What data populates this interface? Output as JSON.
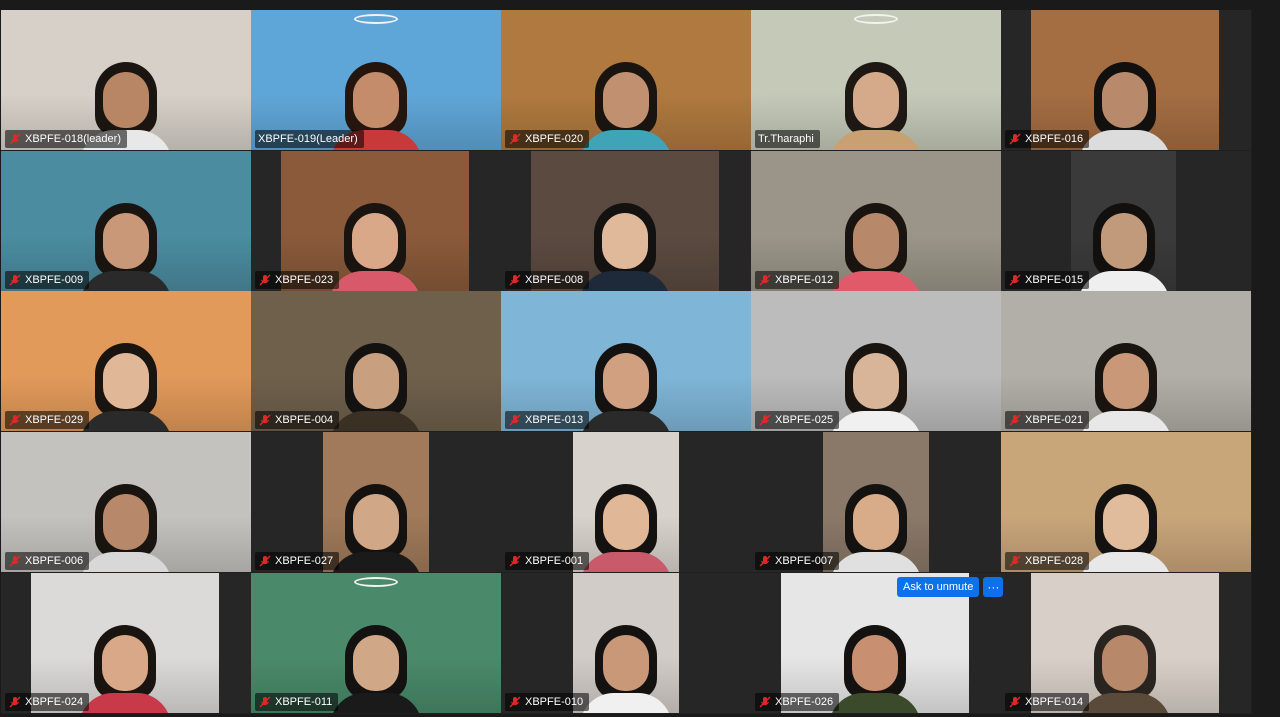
{
  "meeting": {
    "icons": {
      "muted_mic": "muted-mic-icon",
      "halo": "halo-effect-icon",
      "more": "ellipsis-icon"
    },
    "colors": {
      "active_speaker_border": "#23d959",
      "action_blue": "#0e71eb",
      "muted_red": "#e02828"
    },
    "participants": [
      {
        "name": "XBPFE-018(leader)",
        "bg": "#d6d0c8",
        "hair": "#1b1512",
        "skin": "#b88664",
        "cloth": "#e8e8e8",
        "muted": true
      },
      {
        "name": "XBPFE-019(Leader)",
        "bg": "#5fa6d8",
        "hair": "#24160f",
        "skin": "#c48c6a",
        "cloth": "#c83a3a",
        "muted": false,
        "active": true,
        "halo": true
      },
      {
        "name": "XBPFE-020",
        "bg": "#b0793f",
        "hair": "#1a1410",
        "skin": "#c09070",
        "cloth": "#3fa4b8",
        "muted": true
      },
      {
        "name": "Tr.Tharaphi",
        "bg": "#c4c9b8",
        "hair": "#1e1814",
        "skin": "#d4aa8a",
        "cloth": "#c8a071",
        "muted": false,
        "halo": true
      },
      {
        "name": "XBPFE-016",
        "bg": "#a46d42",
        "hair": "#12100e",
        "skin": "#b8896a",
        "cloth": "#dcdcdc",
        "muted": true
      },
      {
        "name": "XBPFE-009",
        "bg": "#4b8ca0",
        "hair": "#1a1410",
        "skin": "#c89878",
        "cloth": "#2a2a2a",
        "muted": true
      },
      {
        "name": "XBPFE-023",
        "bg": "#8a5a3a",
        "hair": "#1a1410",
        "skin": "#d8a888",
        "cloth": "#d85a6a",
        "muted": true
      },
      {
        "name": "XBPFE-008",
        "bg": "#5b4a40",
        "hair": "#141210",
        "skin": "#e0b89a",
        "cloth": "#1e2a3a",
        "muted": true
      },
      {
        "name": "XBPFE-012",
        "bg": "#9a9588",
        "hair": "#1a1410",
        "skin": "#b8886a",
        "cloth": "#e05a6a",
        "muted": true
      },
      {
        "name": "XBPFE-015",
        "bg": "#3a3a3a",
        "hair": "#12100e",
        "skin": "#c09a7a",
        "cloth": "#efefef",
        "muted": true
      },
      {
        "name": "XBPFE-029",
        "bg": "#e29a5a",
        "hair": "#1a1410",
        "skin": "#e0b898",
        "cloth": "#2a2a2a",
        "muted": true
      },
      {
        "name": "XBPFE-004",
        "bg": "#6f604c",
        "hair": "#141210",
        "skin": "#c8a080",
        "cloth": "#3a3024",
        "muted": true
      },
      {
        "name": "XBPFE-013",
        "bg": "#7fb6d8",
        "hair": "#141210",
        "skin": "#d0a080",
        "cloth": "#2a2a2a",
        "muted": true
      },
      {
        "name": "XBPFE-025",
        "bg": "#bcbcbc",
        "hair": "#1a1410",
        "skin": "#d8b498",
        "cloth": "#f0f0f0",
        "muted": true
      },
      {
        "name": "XBPFE-021",
        "bg": "#b2aea8",
        "hair": "#1a1410",
        "skin": "#c89878",
        "cloth": "#e8e8e8",
        "muted": true
      },
      {
        "name": "XBPFE-006",
        "bg": "#c4c2be",
        "hair": "#1a1410",
        "skin": "#b8886a",
        "cloth": "#d8d8d8",
        "muted": true
      },
      {
        "name": "XBPFE-027",
        "bg": "#a07a5a",
        "hair": "#141210",
        "skin": "#d0a888",
        "cloth": "#1a1a1a",
        "muted": true
      },
      {
        "name": "XBPFE-001",
        "bg": "#d8d2cc",
        "hair": "#141210",
        "skin": "#e0b898",
        "cloth": "#c85a6a",
        "muted": true
      },
      {
        "name": "XBPFE-007",
        "bg": "#8a7868",
        "hair": "#141210",
        "skin": "#d8ac88",
        "cloth": "#e0e0e0",
        "muted": true
      },
      {
        "name": "XBPFE-028",
        "bg": "#c9a57a",
        "hair": "#141210",
        "skin": "#e0bc9c",
        "cloth": "#e8e8e8",
        "muted": true
      },
      {
        "name": "XBPFE-024",
        "bg": "#dcdad8",
        "hair": "#1a1410",
        "skin": "#d8a888",
        "cloth": "#c83a4a",
        "muted": true
      },
      {
        "name": "XBPFE-011",
        "bg": "#4a8a6a",
        "hair": "#141210",
        "skin": "#d0a888",
        "cloth": "#1a1a1a",
        "muted": true,
        "halo": true
      },
      {
        "name": "XBPFE-010",
        "bg": "#d2ccc8",
        "hair": "#141210",
        "skin": "#c89878",
        "cloth": "#f0f0f0",
        "muted": true
      },
      {
        "name": "XBPFE-026",
        "bg": "#e6e6e6",
        "hair": "#141210",
        "skin": "#c89070",
        "cloth": "#3a4a2a",
        "muted": true
      },
      {
        "name": "XBPFE-014",
        "bg": "#d8d0c8",
        "hair": "#2a2420",
        "skin": "#b8886a",
        "cloth": "#5a4a3a",
        "muted": true
      }
    ],
    "ask_to_unmute_label": "Ask to unmute",
    "more_options_label": "···"
  }
}
